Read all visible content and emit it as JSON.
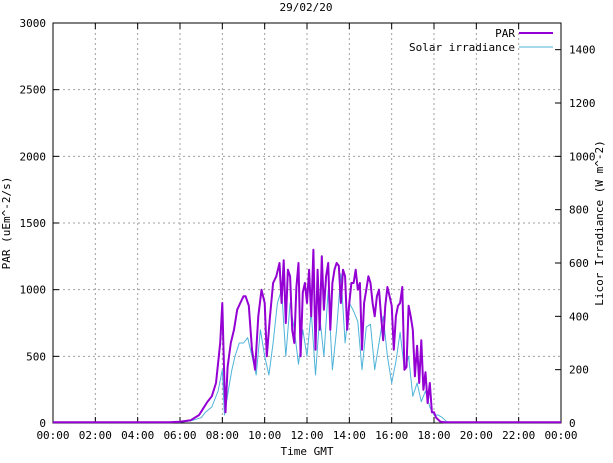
{
  "chart_data": {
    "type": "line",
    "title": "29/02/20",
    "xlabel": "Time GMT",
    "ylabel_left": "PAR (uEm^-2/s)",
    "ylabel_right": "Licor Irradiance (W m^-2)",
    "x_ticks": [
      "00:00",
      "02:00",
      "04:00",
      "06:00",
      "08:00",
      "10:00",
      "12:00",
      "14:00",
      "16:00",
      "18:00",
      "20:00",
      "22:00",
      "00:00"
    ],
    "y_left_ticks": [
      "0",
      "500",
      "1000",
      "1500",
      "2000",
      "2500",
      "3000"
    ],
    "y_right_ticks": [
      "0",
      "200",
      "400",
      "600",
      "800",
      "1000",
      "1200",
      "1400"
    ],
    "xlim_hours": [
      0,
      24
    ],
    "ylim_left": [
      0,
      3000
    ],
    "ylim_right": [
      0,
      1500
    ],
    "grid": true,
    "legend_position": "top-right",
    "series": [
      {
        "name": "PAR",
        "axis": "left",
        "color": "#9400d3",
        "x_hours": [
          0,
          1,
          2,
          3,
          4,
          5,
          5.5,
          6,
          6.5,
          6.9,
          7.1,
          7.3,
          7.5,
          7.7,
          7.9,
          8.0,
          8.1,
          8.15,
          8.25,
          8.4,
          8.55,
          8.7,
          8.85,
          9.0,
          9.1,
          9.25,
          9.4,
          9.55,
          9.7,
          9.85,
          10.0,
          10.1,
          10.25,
          10.4,
          10.55,
          10.7,
          10.8,
          10.9,
          11.0,
          11.1,
          11.2,
          11.3,
          11.4,
          11.5,
          11.6,
          11.7,
          11.8,
          11.9,
          12.0,
          12.1,
          12.2,
          12.3,
          12.4,
          12.5,
          12.6,
          12.7,
          12.8,
          12.9,
          13.0,
          13.1,
          13.2,
          13.3,
          13.4,
          13.5,
          13.6,
          13.7,
          13.8,
          13.9,
          14.0,
          14.1,
          14.2,
          14.3,
          14.4,
          14.5,
          14.6,
          14.7,
          14.8,
          14.9,
          15.0,
          15.1,
          15.2,
          15.3,
          15.4,
          15.5,
          15.6,
          15.7,
          15.8,
          15.9,
          16.0,
          16.1,
          16.2,
          16.3,
          16.4,
          16.5,
          16.6,
          16.7,
          16.8,
          16.9,
          17.0,
          17.1,
          17.2,
          17.3,
          17.4,
          17.5,
          17.6,
          17.7,
          17.8,
          17.9,
          18.0,
          18.1,
          18.3,
          18.5,
          19,
          20,
          21,
          22,
          23,
          24
        ],
        "values": [
          5,
          5,
          5,
          5,
          5,
          5,
          5,
          10,
          20,
          60,
          110,
          160,
          200,
          300,
          600,
          900,
          300,
          80,
          420,
          600,
          700,
          850,
          900,
          950,
          950,
          880,
          550,
          400,
          800,
          1000,
          900,
          500,
          800,
          1050,
          1100,
          1200,
          900,
          1220,
          750,
          1150,
          1100,
          700,
          600,
          1020,
          1200,
          500,
          980,
          1050,
          900,
          1150,
          800,
          1300,
          550,
          1150,
          700,
          1250,
          850,
          1100,
          1200,
          700,
          1050,
          1150,
          1200,
          1180,
          900,
          1150,
          1100,
          700,
          900,
          1050,
          1050,
          1150,
          1000,
          1050,
          550,
          900,
          1000,
          1100,
          1050,
          900,
          800,
          950,
          1000,
          800,
          620,
          880,
          1020,
          950,
          880,
          550,
          800,
          880,
          900,
          1020,
          400,
          420,
          880,
          800,
          700,
          350,
          580,
          300,
          620,
          250,
          380,
          150,
          300,
          80,
          80,
          40,
          10,
          5,
          5,
          5,
          5,
          5,
          5,
          5
        ]
      },
      {
        "name": "Solar irradiance",
        "axis": "right",
        "color": "#4fb3d9",
        "x_hours": [
          0,
          2,
          4,
          5.5,
          6,
          6.5,
          7,
          7.2,
          7.5,
          7.8,
          8.0,
          8.1,
          8.2,
          8.3,
          8.45,
          8.6,
          8.8,
          9.0,
          9.2,
          9.4,
          9.6,
          9.8,
          10.0,
          10.2,
          10.4,
          10.6,
          10.8,
          11.0,
          11.2,
          11.4,
          11.6,
          11.8,
          12.0,
          12.2,
          12.4,
          12.6,
          12.8,
          13.0,
          13.2,
          13.4,
          13.6,
          13.8,
          14.0,
          14.2,
          14.4,
          14.6,
          14.8,
          15.0,
          15.2,
          15.4,
          15.6,
          15.8,
          16.0,
          16.2,
          16.4,
          16.6,
          16.8,
          17.0,
          17.2,
          17.4,
          17.6,
          17.8,
          18.0,
          18.2,
          18.4,
          18.6,
          19,
          20,
          22,
          24
        ],
        "values": [
          2,
          2,
          2,
          2,
          3,
          8,
          20,
          40,
          60,
          120,
          200,
          30,
          80,
          130,
          200,
          250,
          300,
          300,
          320,
          250,
          180,
          350,
          250,
          180,
          300,
          450,
          500,
          250,
          450,
          350,
          220,
          350,
          250,
          420,
          180,
          400,
          250,
          500,
          200,
          350,
          560,
          300,
          450,
          420,
          380,
          200,
          360,
          370,
          200,
          300,
          400,
          250,
          150,
          230,
          340,
          200,
          250,
          100,
          150,
          80,
          120,
          60,
          30,
          30,
          20,
          5,
          2,
          2,
          2,
          2
        ]
      }
    ]
  }
}
